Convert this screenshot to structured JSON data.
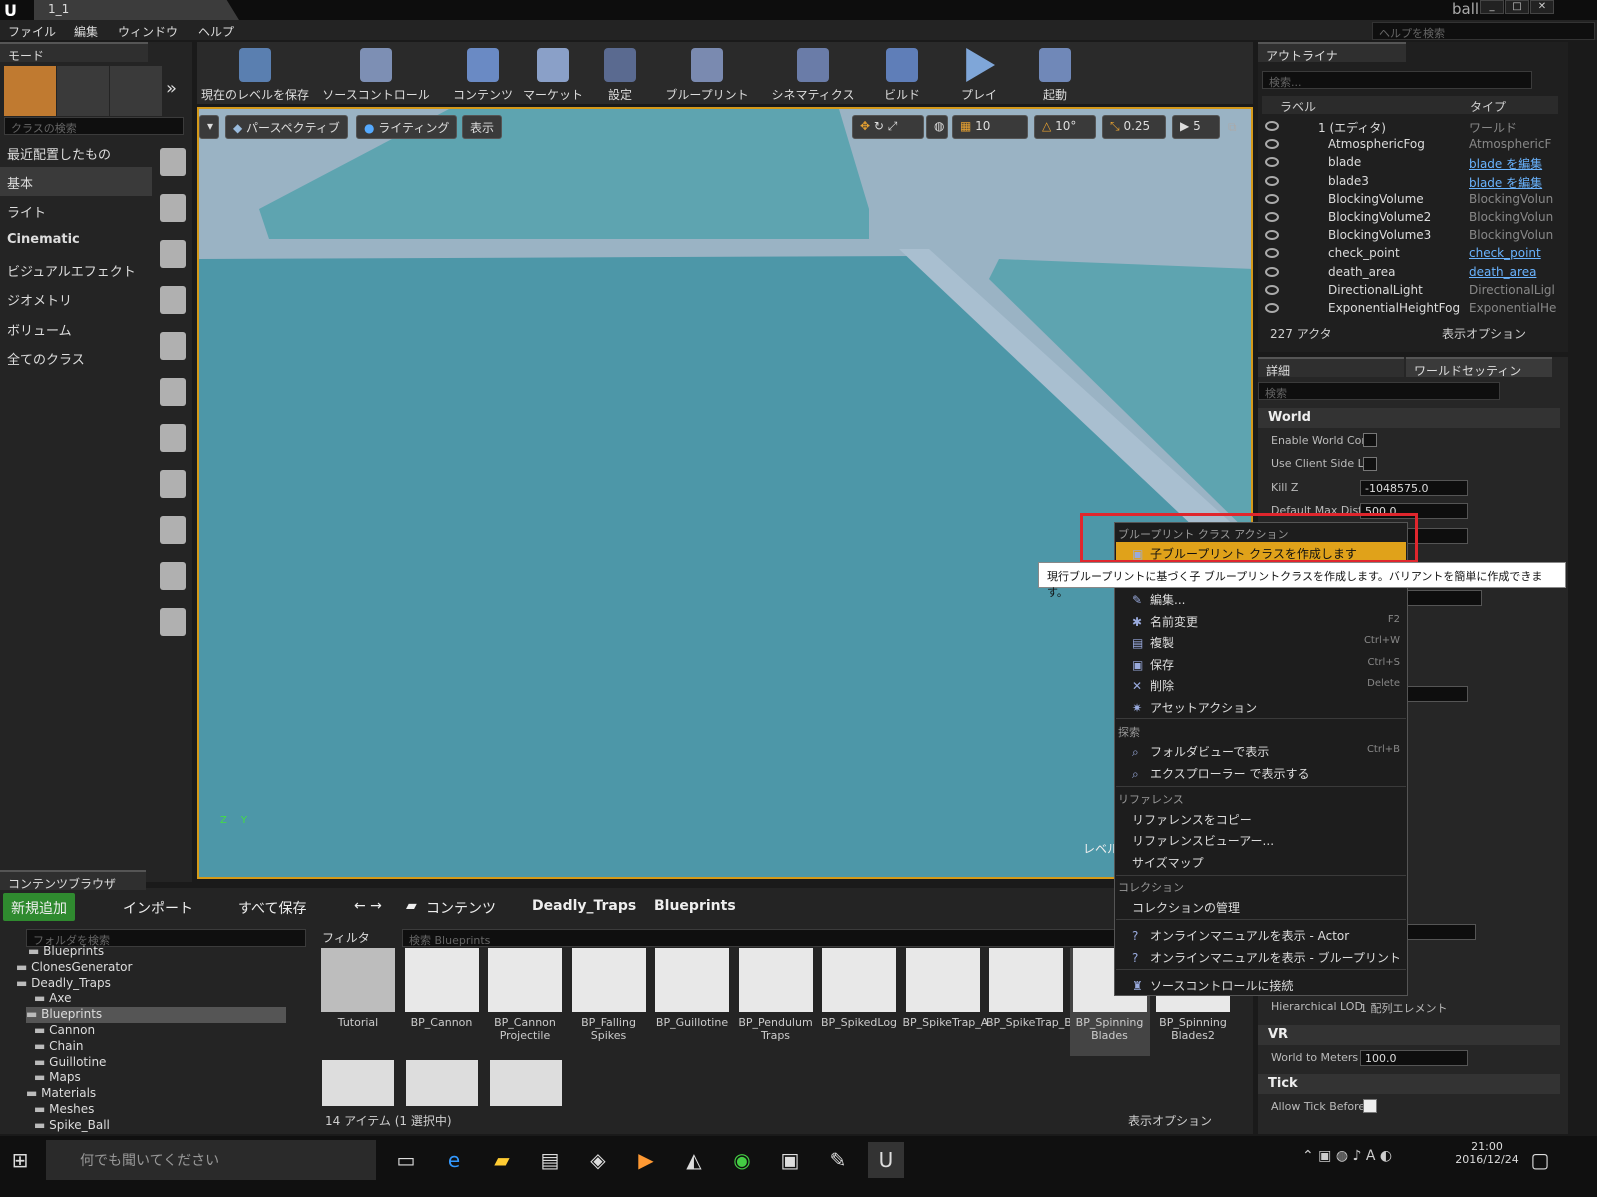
{
  "window": {
    "tab_title": "1_1",
    "project": "ball"
  },
  "menu": [
    "ファイル",
    "編集",
    "ウィンドウ",
    "ヘルプ"
  ],
  "help_search": {
    "placeholder": "ヘルプを検索"
  },
  "modes": {
    "tab": "モード",
    "search_placeholder": "クラスの検索",
    "categories": [
      "最近配置したもの",
      "基本",
      "ライト",
      "Cinematic",
      "ビジュアルエフェクト",
      "ジオメトリ",
      "ボリューム",
      "全てのクラス"
    ]
  },
  "toolbar": [
    "現在のレベルを保存",
    "ソースコントロール",
    "コンテンツ",
    "マーケット",
    "設定",
    "ブループリント",
    "シネマティクス",
    "ビルド",
    "プレイ",
    "起動"
  ],
  "viewport": {
    "perspective": "パースペクティブ",
    "lighting": "ライティング",
    "show": "表示",
    "grid_snap": "10",
    "rot_snap": "10°",
    "scale_snap": "0.25",
    "cam_speed": "5",
    "level_label": "レベル"
  },
  "outliner": {
    "tab": "アウトライナ",
    "search_placeholder": "検索...",
    "col_label": "ラベル",
    "col_type": "タイプ",
    "rows": [
      {
        "label": "1 (エディタ)",
        "type": "ワールド",
        "link": false
      },
      {
        "label": "AtmosphericFog",
        "type": "AtmosphericF",
        "link": false
      },
      {
        "label": "blade",
        "type": "blade を編集",
        "link": true
      },
      {
        "label": "blade3",
        "type": "blade を編集",
        "link": true
      },
      {
        "label": "BlockingVolume",
        "type": "BlockingVolun",
        "link": false
      },
      {
        "label": "BlockingVolume2",
        "type": "BlockingVolun",
        "link": false
      },
      {
        "label": "BlockingVolume3",
        "type": "BlockingVolun",
        "link": false
      },
      {
        "label": "check_point",
        "type": "check_point",
        "link": true
      },
      {
        "label": "death_area",
        "type": "death_area",
        "link": true
      },
      {
        "label": "DirectionalLight",
        "type": "DirectionalLigl",
        "link": false
      },
      {
        "label": "ExponentialHeightFog",
        "type": "ExponentialHe",
        "link": false
      }
    ],
    "count": "227 アクタ",
    "view_options": "表示オプション"
  },
  "details": {
    "tab_details": "詳細",
    "tab_world": "ワールドセッティン",
    "search_placeholder": "検索",
    "world_section": "World",
    "enable_world": "Enable World Con",
    "use_client": "Use Client Side L",
    "kill_z_label": "Kill Z",
    "kill_z": "-1048575.0",
    "default_max": "Default Max Dist",
    "default_max_val": "500.0",
    "hlod": "Hierarchical LOD",
    "hlod_val": "1 配列エレメント",
    "vr_section": "VR",
    "world_to_meters": "World to Meters",
    "wtm_val": "100.0",
    "tick_section": "Tick",
    "allow_tick": "Allow Tick Before"
  },
  "context_menu": {
    "bp_header": "ブループリント クラス アクション",
    "create_child": "子ブループリント クラスを作成します",
    "items": [
      {
        "label": "編集...",
        "shortcut": ""
      },
      {
        "label": "名前変更",
        "shortcut": "F2"
      },
      {
        "label": "複製",
        "shortcut": "Ctrl+W"
      },
      {
        "label": "保存",
        "shortcut": "Ctrl+S"
      },
      {
        "label": "削除",
        "shortcut": "Delete"
      },
      {
        "label": "アセットアクション",
        "shortcut": ""
      }
    ],
    "explore_header": "探索",
    "explore": [
      {
        "label": "フォルダビューで表示",
        "shortcut": "Ctrl+B"
      },
      {
        "label": "エクスプローラー で表示する",
        "shortcut": ""
      }
    ],
    "ref_header": "リファレンス",
    "refs": [
      "リファレンスをコピー",
      "リファレンスビューアー...",
      "サイズマップ"
    ],
    "col_header": "コレクション",
    "col_manage": "コレクションの管理",
    "manual_actor": "オンラインマニュアルを表示 - Actor",
    "manual_bp": "オンラインマニュアルを表示 - ブループリント",
    "source_connect": "ソースコントロールに接続"
  },
  "tooltip": "現行ブループリントに基づく子 ブループリントクラスを作成します。バリアントを簡単に作成できます。",
  "content_browser": {
    "tab": "コンテンツブラウザ",
    "add_new": "新規追加",
    "import": "インポート",
    "save_all": "すべて保存",
    "path": [
      "コンテンツ",
      "Deadly_Traps",
      "Blueprints"
    ],
    "folder_search": "フォルダを検索",
    "filter": "フィルタ",
    "asset_search": "検索 Blueprints",
    "folders": [
      "Blueprints",
      "ClonesGenerator",
      "Deadly_Traps",
      "Axe",
      "Blueprints",
      "Cannon",
      "Chain",
      "Guillotine",
      "Maps",
      "Materials",
      "Meshes",
      "Spike_Ball"
    ],
    "assets": [
      "Tutorial",
      "BP_Cannon",
      "BP_Cannon Projectile",
      "BP_Falling Spikes",
      "BP_Guillotine",
      "BP_Pendulum Traps",
      "BP_SpikedLog",
      "BP_SpikeTrap_A",
      "BP_SpikeTrap_B",
      "BP_Spinning Blades",
      "BP_Spinning Blades2"
    ],
    "status": "14 アイテム (1 選択中)",
    "view_options": "表示オプション"
  },
  "taskbar": {
    "search": "何でも聞いてください",
    "time": "21:00",
    "date": "2016/12/24"
  }
}
